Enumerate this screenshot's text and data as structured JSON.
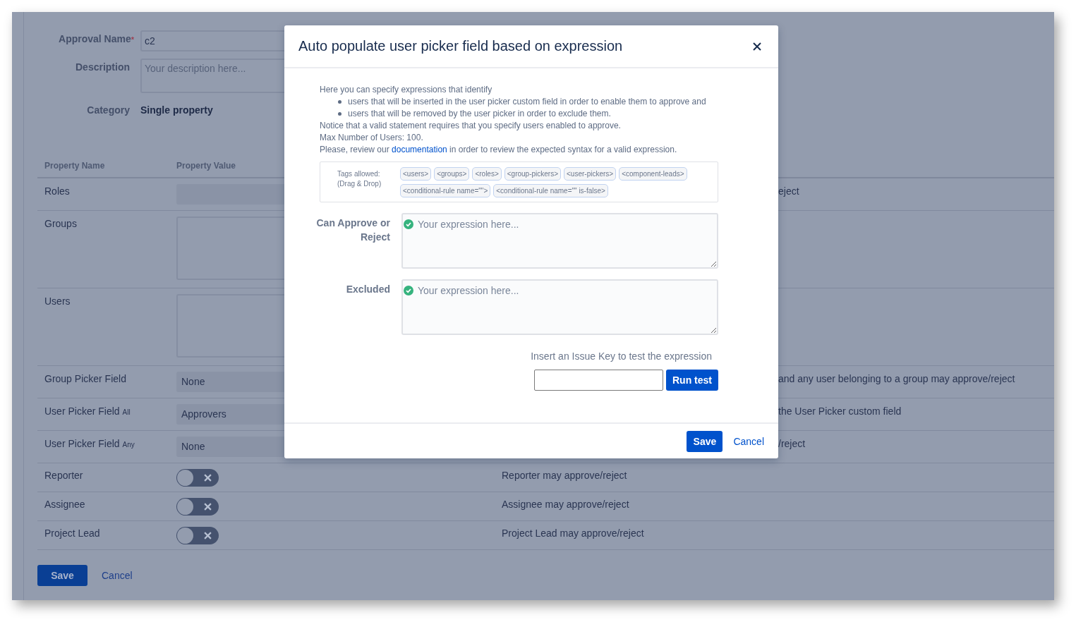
{
  "form": {
    "approval_name": {
      "label": "Approval Name",
      "required_mark": "*",
      "value": "c2"
    },
    "description": {
      "label": "Description",
      "placeholder": "Your description here..."
    },
    "category": {
      "label": "Category",
      "value": "Single property"
    }
  },
  "table": {
    "columns": [
      "Property Name",
      "Property Value"
    ],
    "rows": [
      {
        "kind": "select",
        "name": "Roles",
        "description_tail": "eject"
      },
      {
        "kind": "textarea",
        "name": "Groups"
      },
      {
        "kind": "textarea",
        "name": "Users"
      },
      {
        "kind": "select",
        "name": "Group Picker Field",
        "value": "None",
        "description_tail": "and any user belonging to a group may approve/reject"
      },
      {
        "kind": "select",
        "name": "User Picker Field",
        "qualifier": "All",
        "value": "Approvers",
        "description_tail": "the User Picker custom field"
      },
      {
        "kind": "select",
        "name": "User Picker Field",
        "qualifier": "Any",
        "value": "None",
        "description_tail": "/reject"
      },
      {
        "kind": "toggle",
        "name": "Reporter",
        "on": false,
        "description": "Reporter may approve/reject"
      },
      {
        "kind": "toggle",
        "name": "Assignee",
        "on": false,
        "description": "Assignee may approve/reject"
      },
      {
        "kind": "toggle",
        "name": "Project Lead",
        "on": false,
        "description": "Project Lead may approve/reject"
      }
    ]
  },
  "buttons": {
    "save": "Save",
    "cancel": "Cancel"
  },
  "dialog": {
    "title": "Auto populate user picker field based on expression",
    "intro": "Here you can specify expressions that identify",
    "bullets": [
      "users that will be inserted in the user picker custom field in order to enable them to approve and",
      "users that will be removed by the user picker in order to exclude them."
    ],
    "notes": [
      "Notice that a valid statement requires that you specify users enabled to approve.",
      "Max Number of Users: 100."
    ],
    "doc_sentence": {
      "before": "Please, review our ",
      "link": "documentation",
      "after": " in order to review the expected syntax for a valid expression."
    },
    "tags_label": [
      "Tags allowed:",
      "(Drag & Drop)"
    ],
    "tags": [
      "<users>",
      "<groups>",
      "<roles>",
      "<group-pickers>",
      "<user-pickers>",
      "<component-leads>",
      "<conditional-rule name=\"\">",
      "<conditional-rule name=\"\" is-false>"
    ],
    "expressions": [
      {
        "label": "Can Approve or Reject",
        "placeholder": "Your expression here...",
        "valid": true
      },
      {
        "label": "Excluded",
        "placeholder": "Your expression here...",
        "valid": true
      }
    ],
    "test": {
      "label": "Insert an Issue Key to test the expression",
      "button": "Run test"
    },
    "footer": {
      "save": "Save",
      "cancel": "Cancel"
    }
  }
}
